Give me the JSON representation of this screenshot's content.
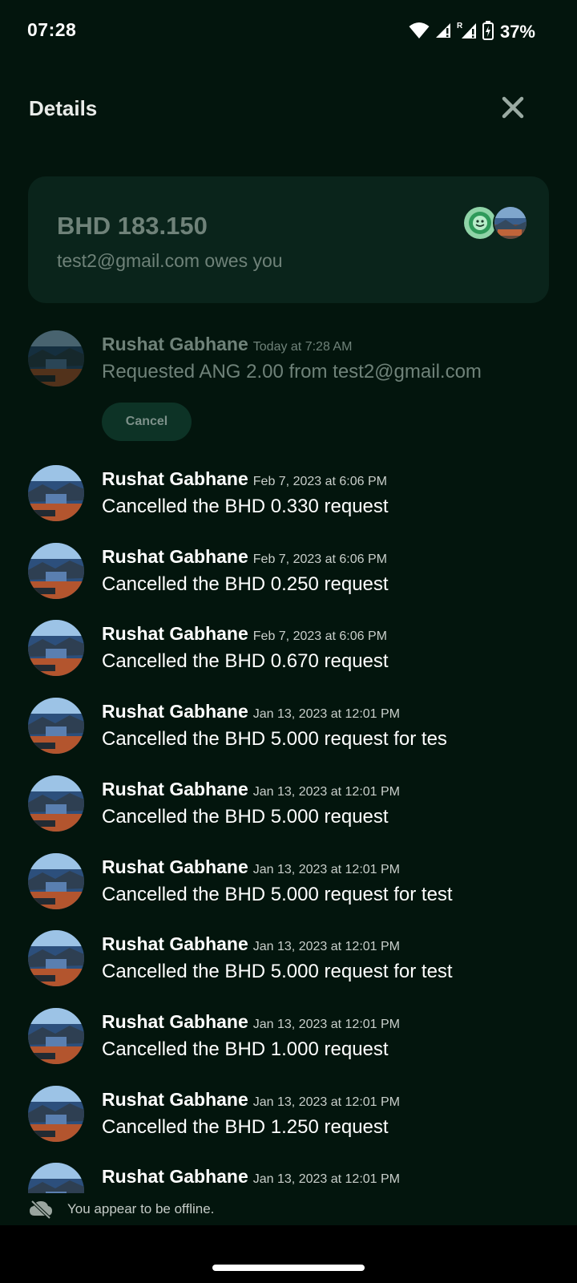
{
  "status_bar": {
    "time": "07:28",
    "battery": "37%",
    "icons": [
      "wifi-icon",
      "signal-icon",
      "signal-roaming-icon",
      "battery-icon"
    ]
  },
  "header": {
    "title": "Details",
    "close_icon": "close-icon"
  },
  "summary": {
    "amount": "BHD 183.150",
    "description": "test2@gmail.com owes you"
  },
  "activity": [
    {
      "name": "Rushat Gabhane",
      "time": "Today at 7:28 AM",
      "desc": "Requested ANG 2.00 from test2@gmail.com",
      "pending": true,
      "action_label": "Cancel"
    },
    {
      "name": "Rushat Gabhane",
      "time": "Feb 7, 2023 at 6:06 PM",
      "desc": "Cancelled the BHD 0.330 request"
    },
    {
      "name": "Rushat Gabhane",
      "time": "Feb 7, 2023 at 6:06 PM",
      "desc": "Cancelled the BHD 0.250 request"
    },
    {
      "name": "Rushat Gabhane",
      "time": "Feb 7, 2023 at 6:06 PM",
      "desc": "Cancelled the BHD 0.670 request"
    },
    {
      "name": "Rushat Gabhane",
      "time": "Jan 13, 2023 at 12:01 PM",
      "desc": "Cancelled the BHD 5.000 request for tes"
    },
    {
      "name": "Rushat Gabhane",
      "time": "Jan 13, 2023 at 12:01 PM",
      "desc": "Cancelled the BHD 5.000 request"
    },
    {
      "name": "Rushat Gabhane",
      "time": "Jan 13, 2023 at 12:01 PM",
      "desc": "Cancelled the BHD 5.000 request for test"
    },
    {
      "name": "Rushat Gabhane",
      "time": "Jan 13, 2023 at 12:01 PM",
      "desc": "Cancelled the BHD 5.000 request for test"
    },
    {
      "name": "Rushat Gabhane",
      "time": "Jan 13, 2023 at 12:01 PM",
      "desc": "Cancelled the BHD 1.000 request"
    },
    {
      "name": "Rushat Gabhane",
      "time": "Jan 13, 2023 at 12:01 PM",
      "desc": "Cancelled the BHD 1.250 request"
    },
    {
      "name": "Rushat Gabhane",
      "time": "Jan 13, 2023 at 12:01 PM",
      "desc": ""
    }
  ],
  "offline": {
    "text": "You appear to be offline.",
    "icon": "cloud-offline-icon"
  },
  "colors": {
    "background": "#03150d",
    "card": "#0a241b",
    "muted_text": "#6f8279",
    "cancel_button": "#0d3326"
  }
}
